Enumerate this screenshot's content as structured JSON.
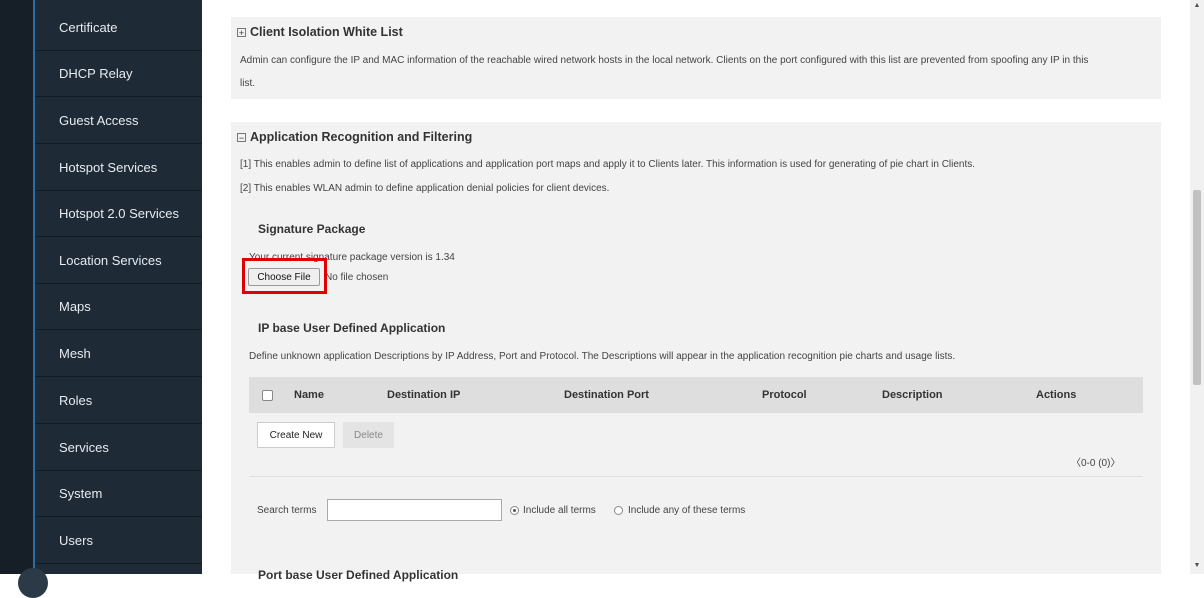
{
  "sidebar": {
    "items": [
      {
        "label": "Certificate"
      },
      {
        "label": "DHCP Relay"
      },
      {
        "label": "Guest Access"
      },
      {
        "label": "Hotspot Services"
      },
      {
        "label": "Hotspot 2.0 Services"
      },
      {
        "label": "Location Services"
      },
      {
        "label": "Maps"
      },
      {
        "label": "Mesh"
      },
      {
        "label": "Roles"
      },
      {
        "label": "Services"
      },
      {
        "label": "System"
      },
      {
        "label": "Users"
      }
    ]
  },
  "client_isolation": {
    "title": "Client Isolation White List",
    "description_line1": "Admin can configure the IP and MAC information of the reachable wired network hosts in the local network. Clients on the port configured with this list are prevented from spoofing any IP in this",
    "description_line2": "list."
  },
  "app_recognition": {
    "title": "Application Recognition and Filtering",
    "note1": "[1] This enables admin to define list of applications and application port maps and apply it to Clients later. This information is used for generating of pie chart in Clients.",
    "note2": "[2] This enables WLAN admin to define application denial policies for client devices.",
    "signature": {
      "title": "Signature Package",
      "version_text": "Your current signature package version is 1.34",
      "choose_file_label": "Choose File",
      "no_file_text": "No file chosen"
    },
    "ip_app": {
      "title": "IP base User Defined Application",
      "description": "Define unknown application Descriptions by IP Address, Port and Protocol. The Descriptions will appear in the application recognition pie charts and usage lists.",
      "columns": [
        "Name",
        "Destination IP",
        "Destination Port",
        "Protocol",
        "Description",
        "Actions"
      ],
      "create_label": "Create New",
      "delete_label": "Delete",
      "pagination": "0-0 (0)"
    },
    "search": {
      "label": "Search terms",
      "value": "",
      "option_all": "Include all terms",
      "option_any": "Include any of these terms",
      "selected": "all"
    },
    "port_app_title": "Port base User Defined Application"
  },
  "colors": {
    "sidebar_bg": "#1e2a36",
    "accent": "#2c6ea3",
    "highlight": "#e00000"
  }
}
